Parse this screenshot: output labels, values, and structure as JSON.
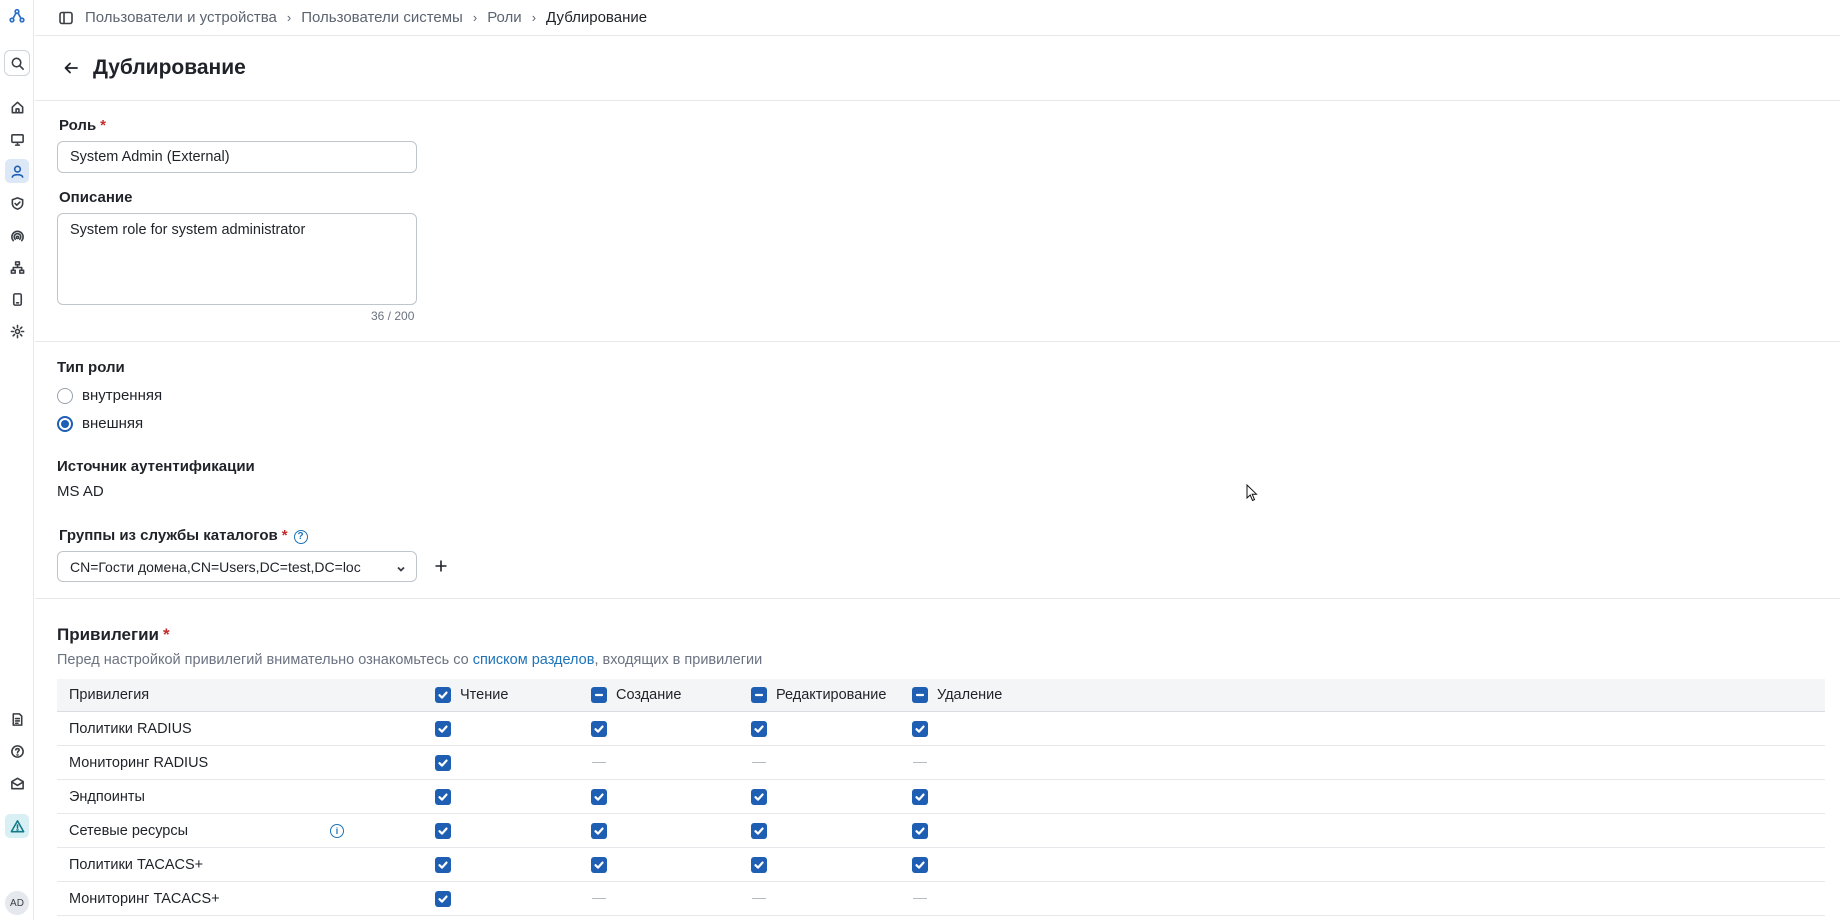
{
  "breadcrumb": {
    "items": [
      "Пользователи и устройства",
      "Пользователи системы",
      "Роли",
      "Дублирование"
    ]
  },
  "page": {
    "title": "Дублирование"
  },
  "form": {
    "role_label": "Роль",
    "role_value": "System Admin (External)",
    "description_label": "Описание",
    "description_value": "System role for system administrator",
    "description_counter": "36 / 200",
    "role_type_label": "Тип роли",
    "role_type_options": [
      "внутренняя",
      "внешняя"
    ],
    "role_type_selected": "внешняя",
    "auth_source_label": "Источник аутентификации",
    "auth_source_value": "MS AD",
    "groups_label": "Группы из службы каталогов",
    "groups_value": "CN=Гости домена,CN=Users,DC=test,DC=loc"
  },
  "privileges": {
    "title": "Привилегии",
    "hint_before": "Перед настройкой привилегий внимательно ознакомьтесь со ",
    "hint_link": "списком разделов",
    "hint_after": ", входящих в привилегии",
    "columns": [
      "Привилегия",
      "Чтение",
      "Создание",
      "Редактирование",
      "Удаление"
    ],
    "header_states": [
      "checked",
      "partial",
      "partial",
      "partial"
    ],
    "rows": [
      {
        "name": "Политики RADIUS",
        "cells": [
          "checked",
          "checked",
          "checked",
          "checked"
        ]
      },
      {
        "name": "Мониторинг RADIUS",
        "cells": [
          "checked",
          "none",
          "none",
          "none"
        ]
      },
      {
        "name": "Эндпоинты",
        "cells": [
          "checked",
          "checked",
          "checked",
          "checked"
        ]
      },
      {
        "name": "Сетевые ресурсы",
        "cells": [
          "checked",
          "checked",
          "checked",
          "checked"
        ],
        "info": true
      },
      {
        "name": "Политики TACACS+",
        "cells": [
          "checked",
          "checked",
          "checked",
          "checked"
        ]
      },
      {
        "name": "Мониторинг TACACS+",
        "cells": [
          "checked",
          "none",
          "none",
          "none"
        ]
      }
    ]
  },
  "sidebar": {
    "avatar_initials": "AD",
    "icons": [
      "logo-icon",
      "search-icon",
      "home-icon",
      "monitor-icon",
      "user-icon",
      "shield-icon",
      "radius-icon",
      "network-icon",
      "device-icon",
      "gear-icon",
      "document-icon",
      "help-icon",
      "mail-icon",
      "warning-icon"
    ]
  },
  "colors": {
    "accent": "#1e5fb3",
    "link": "#1e73b8",
    "required": "#c22d2d"
  }
}
